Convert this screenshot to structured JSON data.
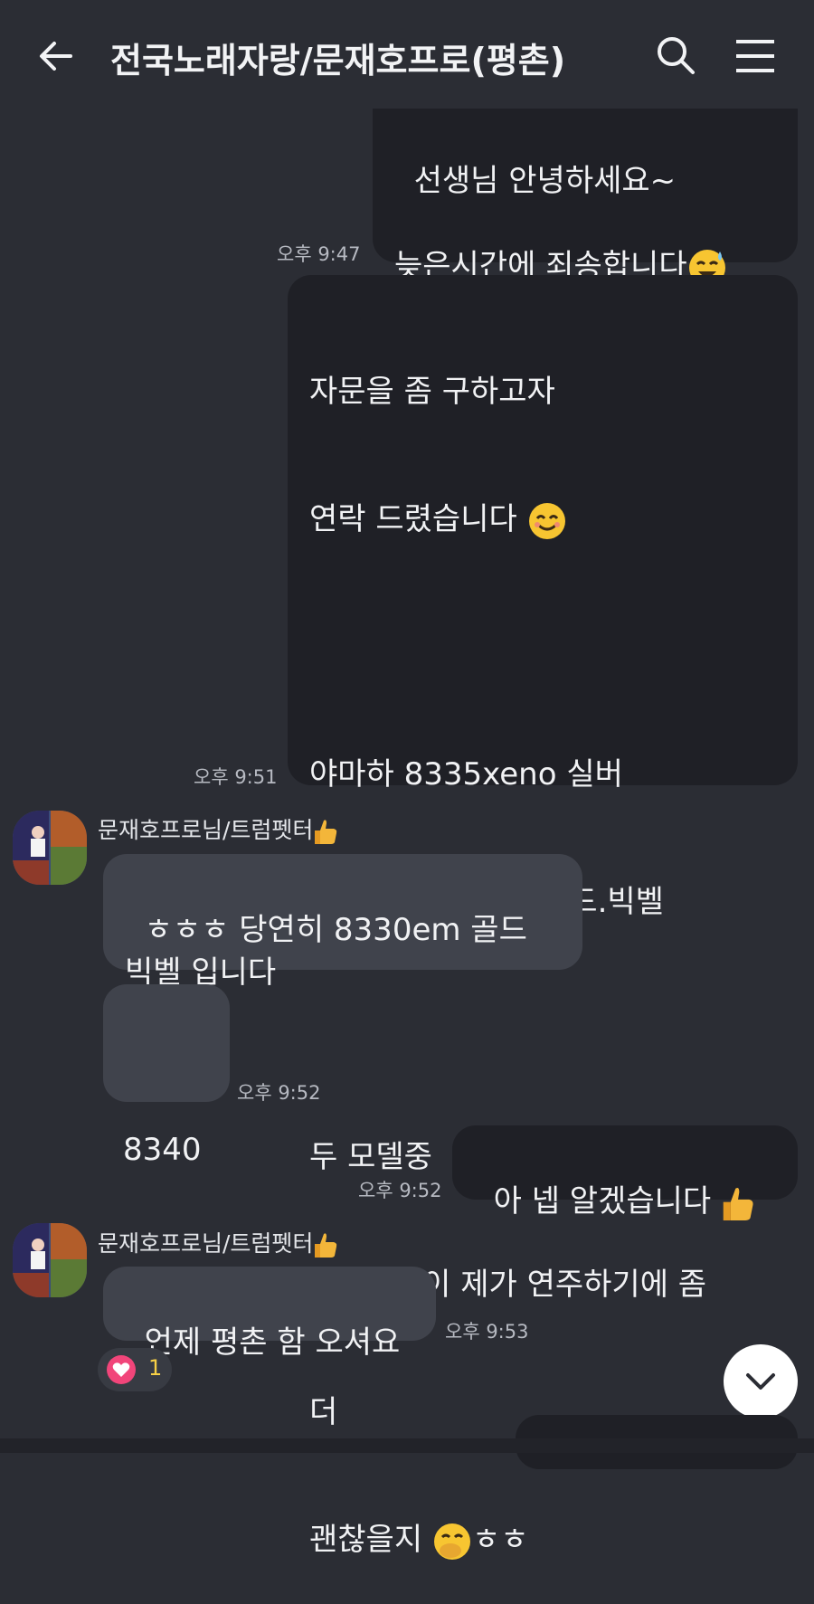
{
  "header": {
    "title": "전국노래자랑/문재호프로(평촌)"
  },
  "messages": {
    "m1": {
      "text": "선생님 안녕하세요~\n\n늦은시간에 죄송합니다",
      "time": "오후 9:47"
    },
    "m2": {
      "line1": "자문을 좀 구하고자",
      "line2": "연락 드렸습니다 ",
      "line3": "야마하 8335xeno 실버",
      "line4": "야마하 8340em 골드.빅벨",
      "line5": "두 모델중",
      "line6": "어떤모델이 제가 연주하기에 좀",
      "line7": "더",
      "line8a": "괜찮을지 ",
      "line8b": "ㅎㅎ",
      "time": "오후 9:51"
    },
    "sender1": {
      "name": "문재호프로님/트럼펫터"
    },
    "m3": {
      "text": "ㅎㅎㅎ 당연히 8330em 골드\n빅벨 입니다"
    },
    "m4": {
      "text": "8340",
      "time": "오후 9:52"
    },
    "m5": {
      "text": "아 넵 알겠습니다 ",
      "time": "오후 9:52"
    },
    "sender2": {
      "name": "문재호프로님/트럼펫터"
    },
    "m6": {
      "text": "언제 평촌 함 오셔요",
      "time": "오후 9:53"
    }
  },
  "reaction": {
    "icon": "heart-icon",
    "count": "1",
    "color": "#f1457a"
  },
  "icons": {
    "back": "back-arrow-icon",
    "search": "search-icon",
    "menu": "hamburger-menu-icon",
    "scroll": "chevron-down-icon"
  }
}
